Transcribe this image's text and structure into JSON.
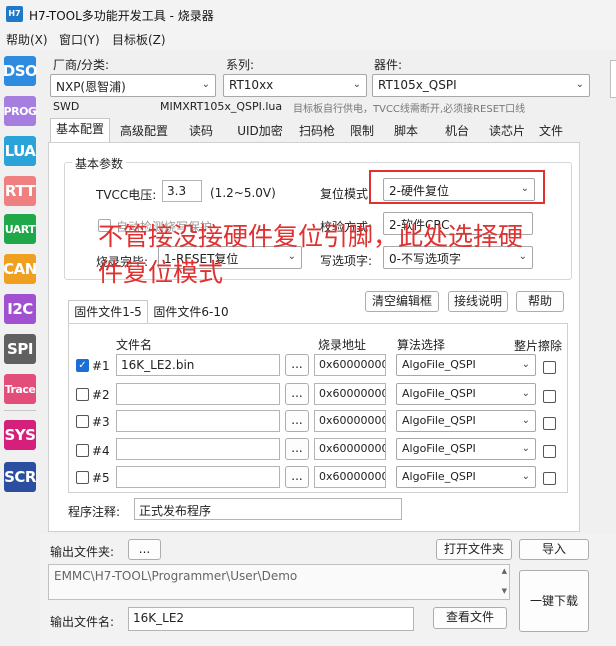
{
  "window": {
    "app_icon": "H7",
    "title": "H7-TOOL多功能开发工具 - 烧录器"
  },
  "menu": [
    "帮助(X)",
    "窗口(Y)",
    "目标板(Z)"
  ],
  "sidebar": [
    "DSO",
    "PROG",
    "LUA",
    "RTT",
    "UART",
    "CAN",
    "I2C",
    "SPI",
    "Trace",
    "SYS",
    "SCR"
  ],
  "device": {
    "vendor_label": "厂商/分类:",
    "vendor_value": "NXP(恩智浦)",
    "series_label": "系列:",
    "series_value": "RT10xx",
    "device_label": "器件:",
    "device_value": "RT105x_QSPI",
    "interface": "SWD",
    "lua_file": "MIMXRT105x_QSPI.lua",
    "hint": "目标板自行供电，TVCC线需断开,必须接RESET口线"
  },
  "tabs": [
    "基本配置",
    "高级配置",
    "读码",
    "UID加密",
    "扫码枪",
    "限制",
    "脚本",
    "机台",
    "读芯片",
    "文件"
  ],
  "basic": {
    "group_title": "基本参数",
    "tvcc_label": "TVCC电压:",
    "tvcc_value": "3.3",
    "tvcc_range": "(1.2~5.0V)",
    "reset_label": "复位模式:",
    "reset_value": "2-硬件复位",
    "autodetect_label": "自动检测烧写保护",
    "verify_label": "校验方式:",
    "verify_value": "2-软件CRC",
    "finish_label": "烧录完毕:",
    "finish_value": "1-RESET复位",
    "write_opt_label": "写选项字:",
    "write_opt_value": "0-不写选项字"
  },
  "annotation": {
    "line1": "不管接没接硬件复位引脚，此处选择硬",
    "line2": "件复位模式"
  },
  "buttons": {
    "clear_editor": "清空编辑框",
    "wiring": "接线说明",
    "help": "帮助"
  },
  "file_tabs": [
    "固件文件1-5",
    "固件文件6-10"
  ],
  "file_table": {
    "col_filename": "文件名",
    "col_address": "烧录地址",
    "col_algo": "算法选择",
    "col_erase": "整片擦除",
    "browse": "...",
    "rows": [
      {
        "label": "#1",
        "checked": true,
        "filename": "16K_LE2.bin",
        "address": "0x60000000",
        "algo": "AlgoFile_QSPI"
      },
      {
        "label": "#2",
        "checked": false,
        "filename": "",
        "address": "0x60000000",
        "algo": "AlgoFile_QSPI"
      },
      {
        "label": "#3",
        "checked": false,
        "filename": "",
        "address": "0x60000000",
        "algo": "AlgoFile_QSPI"
      },
      {
        "label": "#4",
        "checked": false,
        "filename": "",
        "address": "0x60000000",
        "algo": "AlgoFile_QSPI"
      },
      {
        "label": "#5",
        "checked": false,
        "filename": "",
        "address": "0x60000000",
        "algo": "AlgoFile_QSPI"
      }
    ]
  },
  "program_note": {
    "label": "程序注释:",
    "value": "正式发布程序"
  },
  "output": {
    "folder_label": "输出文件夹:",
    "browse": "...",
    "open_folder": "打开文件夹",
    "import": "导入",
    "path": "EMMC\\H7-TOOL\\Programmer\\User\\Demo",
    "name_label": "输出文件名:",
    "name_value": "16K_LE2",
    "view_file": "查看文件",
    "download": "一键下载"
  },
  "colors": {
    "DSO": "#2d8be0",
    "PROG": "#a57ee0",
    "LUA": "#2aa3d8",
    "RTT": "#f07f7f",
    "UART": "#1fa84a",
    "CAN": "#f0a020",
    "I2C": "#a050d0",
    "SPI": "#606060",
    "Trace": "#e24d7a",
    "SYS": "#d4207a",
    "SCR": "#2b4ea0",
    "annotation": "#e03030"
  }
}
